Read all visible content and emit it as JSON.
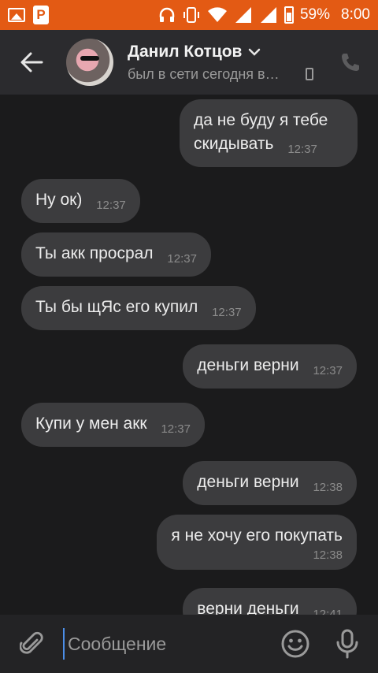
{
  "status_bar": {
    "battery_percent": "59%",
    "time": "8:00",
    "icons": [
      "image-icon",
      "p-app-icon",
      "headphones-icon",
      "vibrate-icon",
      "wifi-icon",
      "signal-icon",
      "signal-icon",
      "battery-icon"
    ],
    "color": "#e35a14"
  },
  "header": {
    "contact_name": "Данил Котцов",
    "last_seen": "был в сети сегодня в…",
    "icons": [
      "back-arrow-icon",
      "chevron-down-icon",
      "mobile-device-icon",
      "phone-icon"
    ]
  },
  "messages": [
    {
      "direction": "out",
      "text": "да не буду я тебе скидывать",
      "time": "12:37"
    },
    {
      "direction": "in",
      "text": "Ну ок)",
      "time": "12:37"
    },
    {
      "direction": "in",
      "text": "Ты акк просрал",
      "time": "12:37"
    },
    {
      "direction": "in",
      "text": "Ты бы щЯс его купил",
      "time": "12:37"
    },
    {
      "direction": "out",
      "text": "деньги верни",
      "time": "12:37"
    },
    {
      "direction": "in",
      "text": "Купи у мен акк",
      "time": "12:37"
    },
    {
      "direction": "out",
      "text": "деньги верни",
      "time": "12:38"
    },
    {
      "direction": "out",
      "text": "я не хочу его покупать",
      "time": "12:38"
    },
    {
      "direction": "out",
      "text": "верни деньги",
      "time": "12:41"
    }
  ],
  "composer": {
    "placeholder": "Сообщение",
    "icons": [
      "paperclip-icon",
      "emoji-icon",
      "microphone-icon"
    ]
  },
  "colors": {
    "background": "#1b1b1c",
    "header": "#2b2b2e",
    "bubble": "#3c3c3e",
    "accent": "#4c8ee8"
  }
}
